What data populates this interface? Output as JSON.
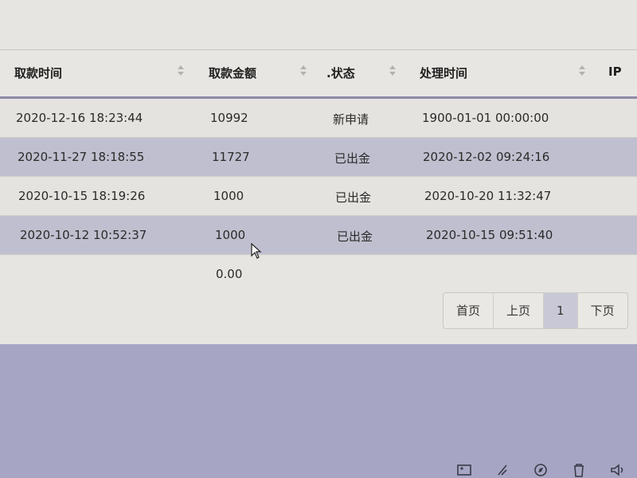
{
  "table": {
    "headers": [
      {
        "label": "取款时间",
        "sortable": true
      },
      {
        "label": "取款金额",
        "sortable": true
      },
      {
        "label": ".状态",
        "sortable": true
      },
      {
        "label": "处理时间",
        "sortable": true
      },
      {
        "label": "IP",
        "sortable": false
      }
    ],
    "rows": [
      {
        "time": "2020-12-16 18:23:44",
        "amount": "10992",
        "status": "新申请",
        "processed": "1900-01-01 00:00:00"
      },
      {
        "time": "2020-11-27 18:18:55",
        "amount": "11727",
        "status": "已出金",
        "processed": "2020-12-02 09:24:16"
      },
      {
        "time": "2020-10-15 18:19:26",
        "amount": "1000",
        "status": "已出金",
        "processed": "2020-10-20 11:32:47"
      },
      {
        "time": "2020-10-12 10:52:37",
        "amount": "1000",
        "status": "已出金",
        "processed": "2020-10-15 09:51:40"
      }
    ],
    "total_amount": "0.00"
  },
  "pager": {
    "first": "首页",
    "prev": "上页",
    "current": "1",
    "next": "下页"
  },
  "colors": {
    "row_alt": "#bfbfcf",
    "row_normal": "#e4e3df",
    "header_border": "#8e8ba8",
    "lower_bg": "#a6a6c4"
  },
  "icons": [
    "image-icon",
    "rocket-icon",
    "compass-icon",
    "trash-icon",
    "speaker-icon"
  ]
}
